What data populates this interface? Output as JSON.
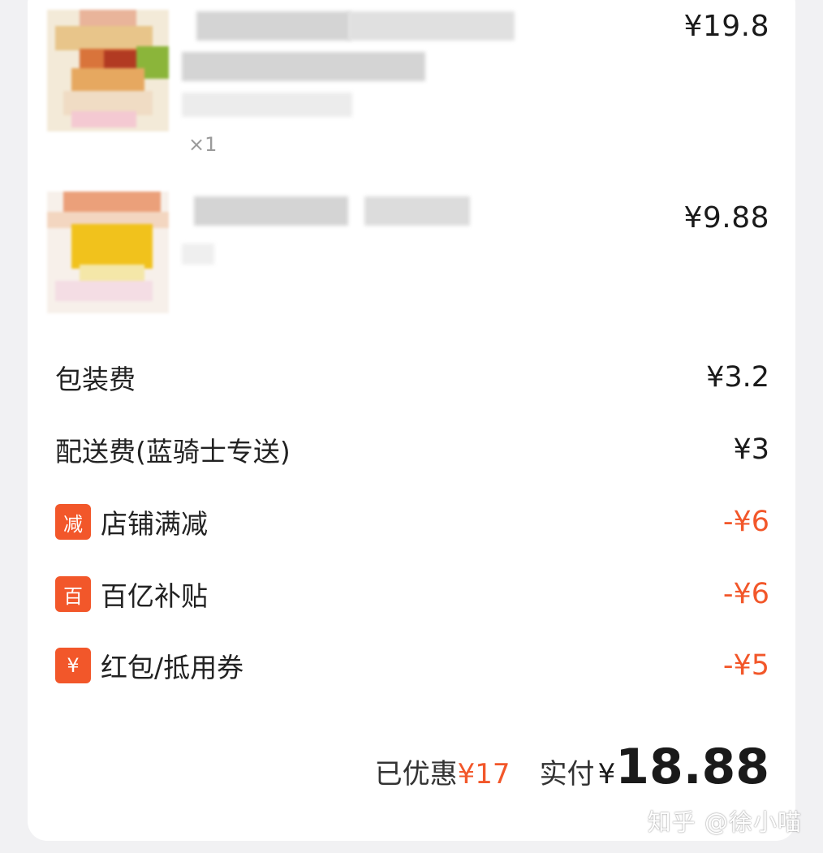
{
  "items": [
    {
      "qty": "×1",
      "price": "¥19.8"
    },
    {
      "qty": "",
      "price": "¥9.88"
    }
  ],
  "fees": {
    "packaging": {
      "label": "包装费",
      "amount": "¥3.2"
    },
    "delivery": {
      "label": "配送费(蓝骑士专送)",
      "amount": "¥3"
    }
  },
  "discounts": [
    {
      "badge": "减",
      "label": "店铺满减",
      "amount": "-¥6"
    },
    {
      "badge": "百",
      "label": "百亿补贴",
      "amount": "-¥6"
    },
    {
      "badge": "¥",
      "label": "红包/抵用券",
      "amount": "-¥5"
    }
  ],
  "summary": {
    "saved_label": "已优惠",
    "saved_amount": "¥17",
    "paid_label": "实付",
    "currency": "¥",
    "paid_amount": "18.88"
  },
  "watermark": "知乎 @徐小喵",
  "colors": {
    "accent": "#f2572a",
    "page_bg": "#f1f1f3",
    "card_bg": "#ffffff"
  }
}
